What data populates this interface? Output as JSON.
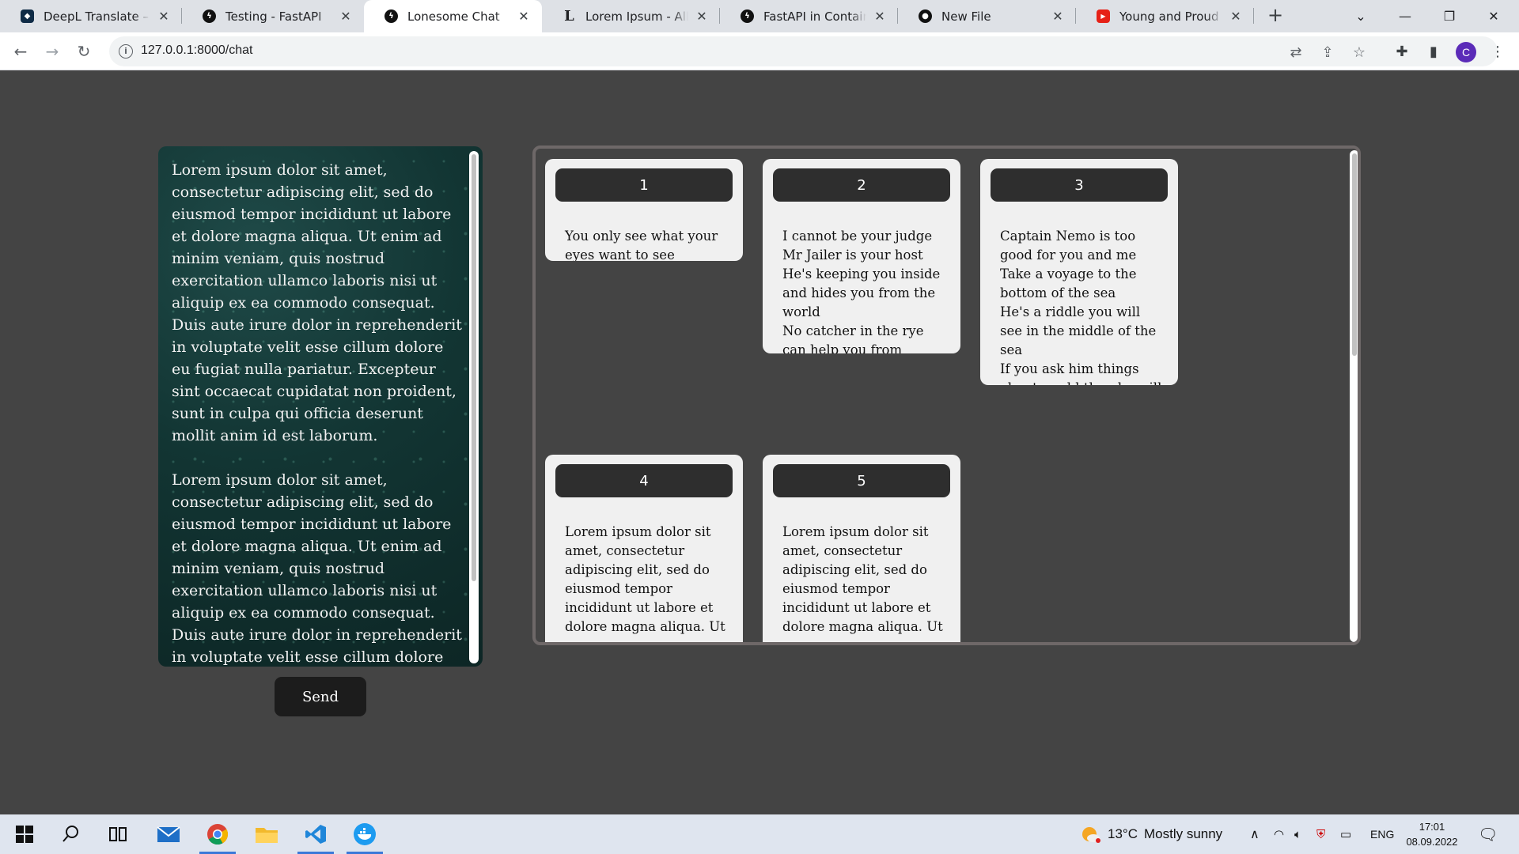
{
  "browser": {
    "tabs": [
      {
        "title": "DeepL Translate – Cat",
        "icon": "deepl-icon",
        "active": false
      },
      {
        "title": "Testing - FastAPI",
        "icon": "fastapi-icon",
        "active": false
      },
      {
        "title": "Lonesome Chat",
        "icon": "fastapi-icon",
        "active": true
      },
      {
        "title": "Lorem Ipsum - All the",
        "icon": "lorem-ipsum-icon",
        "active": false
      },
      {
        "title": "FastAPI in Containers",
        "icon": "fastapi-icon",
        "active": false
      },
      {
        "title": "New File",
        "icon": "github-icon",
        "active": false
      },
      {
        "title": "Young and Proud - Yo",
        "icon": "youtube-icon",
        "active": false
      }
    ],
    "new_tab": "+",
    "url": "127.0.0.1:8000/chat",
    "profile_initial": "C",
    "profile_color": "#5b2bb8"
  },
  "chat": {
    "messages": [
      "Lorem ipsum dolor sit amet, consectetur adipiscing elit, sed do eiusmod tempor incididunt ut labore et dolore magna aliqua. Ut enim ad minim veniam, quis nostrud exercitation ullamco laboris nisi ut aliquip ex ea commodo consequat. Duis aute irure dolor in reprehenderit in voluptate velit esse cillum dolore eu fugiat nulla pariatur. Excepteur sint occaecat cupidatat non proident, sunt in culpa qui officia deserunt mollit anim id est laborum.",
      "Lorem ipsum dolor sit amet, consectetur adipiscing elit, sed do eiusmod tempor incididunt ut labore et dolore magna aliqua. Ut enim ad minim veniam, quis nostrud exercitation ullamco laboris nisi ut aliquip ex ea commodo consequat. Duis aute irure dolor in reprehenderit in voluptate velit esse cillum dolore eu fugiat nulla"
    ],
    "send_label": "Send"
  },
  "cards": [
    {
      "number": "1",
      "text": "You only see what your eyes want to see"
    },
    {
      "number": "2",
      "text": "I cannot be your judge\nMr Jailer is your host\nHe's keeping you inside and hides you from the world\nNo catcher in the rye can help you from yourself"
    },
    {
      "number": "3",
      "text": "Captain Nemo is too good for you and me\nTake a voyage to the bottom of the sea\nHe's a riddle you will see in the middle of the sea\nIf you ask him things about world then he will say..."
    },
    {
      "number": "4",
      "text": "Lorem ipsum dolor sit amet, consectetur adipiscing elit, sed do eiusmod tempor incididunt ut labore et dolore magna aliqua. Ut"
    },
    {
      "number": "5",
      "text": "Lorem ipsum dolor sit amet, consectetur adipiscing elit, sed do eiusmod tempor incididunt ut labore et dolore magna aliqua. Ut"
    }
  ],
  "taskbar": {
    "apps": [
      "windows-start-icon",
      "search-icon",
      "task-view-icon",
      "mail-icon",
      "chrome-icon",
      "file-explorer-icon",
      "vscode-icon",
      "docker-icon"
    ],
    "weather_temp": "13°C",
    "weather_text": "Mostly sunny",
    "language": "ENG",
    "time": "17:01",
    "date": "08.09.2022"
  }
}
